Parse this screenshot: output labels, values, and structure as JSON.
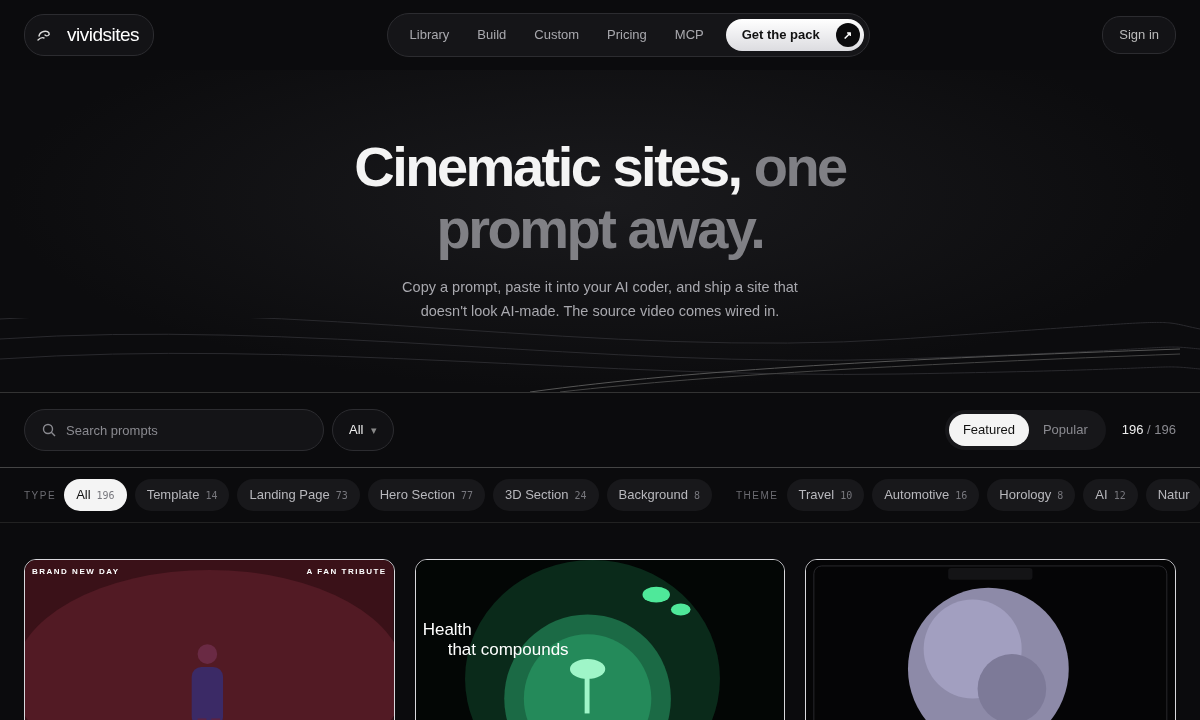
{
  "brand": {
    "name": "vividsites"
  },
  "nav": [
    {
      "label": "Library"
    },
    {
      "label": "Build"
    },
    {
      "label": "Custom"
    },
    {
      "label": "Pricing"
    },
    {
      "label": "MCP"
    }
  ],
  "cta": {
    "label": "Get the pack",
    "icon": "↗"
  },
  "sign_in": {
    "label": "Sign in"
  },
  "hero": {
    "title_lead": "Cinematic sites,",
    "title_rest": "one prompt away.",
    "subtitle": "Copy a prompt, paste it into your AI coder, and ship a site that doesn't look AI-made. The source video comes wired in."
  },
  "search": {
    "placeholder": "Search prompts"
  },
  "filter_select": {
    "value": "All",
    "caret": "▾"
  },
  "sort": [
    {
      "label": "Featured",
      "selected": true
    },
    {
      "label": "Popular",
      "selected": false
    }
  ],
  "count": {
    "shown": "196",
    "total": "/ 196"
  },
  "chip_groups": [
    {
      "label": "TYPE",
      "chips": [
        {
          "label": "All",
          "count": "196",
          "selected": true
        },
        {
          "label": "Template",
          "count": "14",
          "selected": false
        },
        {
          "label": "Landing Page",
          "count": "73",
          "selected": false
        },
        {
          "label": "Hero Section",
          "count": "77",
          "selected": false
        },
        {
          "label": "3D Section",
          "count": "24",
          "selected": false
        },
        {
          "label": "Background",
          "count": "8",
          "selected": false
        }
      ]
    },
    {
      "label": "THEME",
      "chips": [
        {
          "label": "Travel",
          "count": "10",
          "selected": false
        },
        {
          "label": "Automotive",
          "count": "16",
          "selected": false
        },
        {
          "label": "Horology",
          "count": "8",
          "selected": false
        },
        {
          "label": "AI",
          "count": "12",
          "selected": false
        },
        {
          "label": "Natur",
          "selected": false
        }
      ]
    }
  ],
  "cards": [
    {
      "kind": "red",
      "texts": [
        "BRAND NEW DAY",
        "A FAN TRIBUTE"
      ]
    },
    {
      "kind": "green",
      "texts": [
        "Health",
        "that compounds"
      ]
    },
    {
      "kind": "sphere"
    }
  ]
}
